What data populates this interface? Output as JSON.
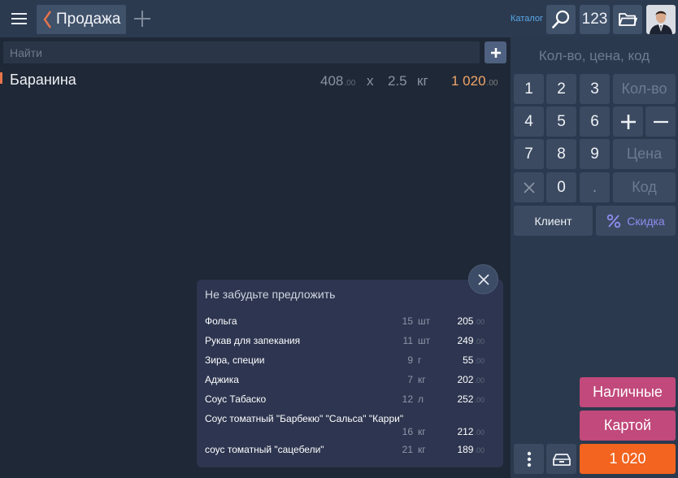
{
  "header": {
    "tab_title": "Продажа",
    "catalog_label": "Каталог",
    "counter_label": "123"
  },
  "search": {
    "placeholder": "Найти"
  },
  "order_line": {
    "name": "Баранина",
    "price": "408",
    "price_cents": ".00",
    "multiply": "x",
    "quantity": "2.5",
    "unit": "кг",
    "total": "1 020",
    "total_cents": ".00"
  },
  "keypad": {
    "display_placeholder": "Кол-во, цена, код",
    "digits": [
      "1",
      "2",
      "3",
      "4",
      "5",
      "6",
      "7",
      "8",
      "9",
      "0",
      "."
    ],
    "qty_label": "Кол-во",
    "price_label": "Цена",
    "code_label": "Код",
    "client_label": "Клиент",
    "discount_label": "Скидка"
  },
  "payment": {
    "cash_label": "Наличные",
    "card_label": "Картой",
    "total_label": "1 020"
  },
  "suggestions": {
    "title": "Не забудьте предложить",
    "items": [
      {
        "name": "Фольга",
        "qty": "15",
        "unit": "шт",
        "price": "205",
        "cents": ".00"
      },
      {
        "name": "Рукав для запекания",
        "qty": "11",
        "unit": "шт",
        "price": "249",
        "cents": ".00"
      },
      {
        "name": "Зира, специи",
        "qty": "9",
        "unit": "г",
        "price": "55",
        "cents": ".00"
      },
      {
        "name": "Аджика",
        "qty": "7",
        "unit": "кг",
        "price": "202",
        "cents": ".00"
      },
      {
        "name": "Соус Табаско",
        "qty": "12",
        "unit": "л",
        "price": "252",
        "cents": ".00"
      },
      {
        "name": "Соус томатный \"Барбекю\" \"Сальса\" \"Карри\"",
        "qty": "16",
        "unit": "кг",
        "price": "212",
        "cents": ".00"
      },
      {
        "name": "соус томатный \"сацебели\"",
        "qty": "21",
        "unit": "кг",
        "price": "189",
        "cents": ".00"
      }
    ]
  },
  "colors": {
    "accent_total": "#f2641f",
    "pay_button": "#c1497b",
    "discount": "#8f8cf0",
    "catalog_link": "#58a8e8"
  }
}
